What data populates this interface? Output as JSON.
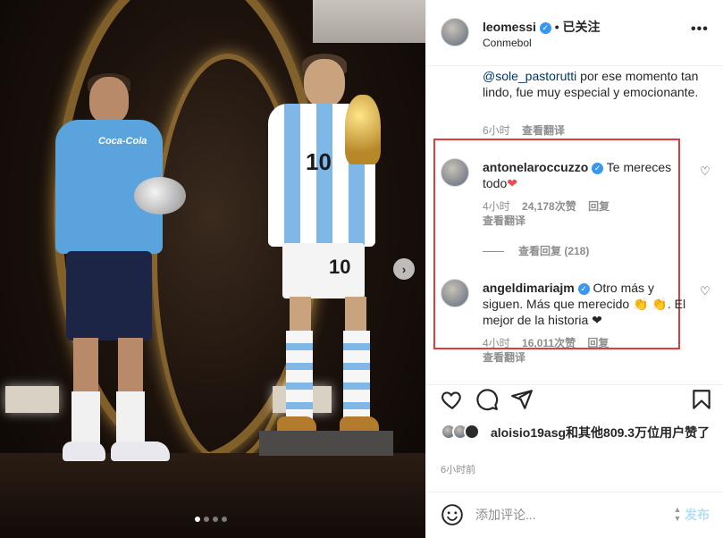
{
  "post": {
    "author": "leomessi",
    "follow_label": "已关注",
    "location": "Conmebol",
    "more_label": "•••",
    "carousel_next": "›"
  },
  "caption": {
    "mention": "@sole_pastorutti",
    "text": " por ese momento tan lindo, fue muy especial y emocionante.",
    "time": "6小时",
    "translate_label": "查看翻译"
  },
  "comments": [
    {
      "user": "antonelaroccuzzo",
      "text": "Te mereces todo",
      "emoji": "❤",
      "time": "4小时",
      "likes": "24,178次赞",
      "reply_label": "回复",
      "translate_label": "查看翻译",
      "view_replies": "查看回复 (218)"
    },
    {
      "user": "angeldimariajm",
      "text": "Otro más y siguen. Más que merecido 👏 👏. El mejor de la historia ❤",
      "time": "4小时",
      "likes": "16,011次赞",
      "reply_label": "回复",
      "translate_label": "查看翻译"
    }
  ],
  "actions": {
    "liked_by": "aloisio19asg和其他809.3万位用户赞了",
    "post_time": "6小时前"
  },
  "composer": {
    "placeholder": "添加评论...",
    "post_label": "发布"
  },
  "icons": {
    "verified": "verified-badge-icon",
    "like": "heart-outline-icon",
    "comment": "speech-bubble-icon",
    "share": "paper-plane-icon",
    "save": "bookmark-icon",
    "emoji": "smiley-icon"
  },
  "colors": {
    "verified": "#3897f0",
    "highlight_border": "#e23b3b",
    "heart": "#ed4956",
    "post_button_disabled": "#b2dffc"
  }
}
